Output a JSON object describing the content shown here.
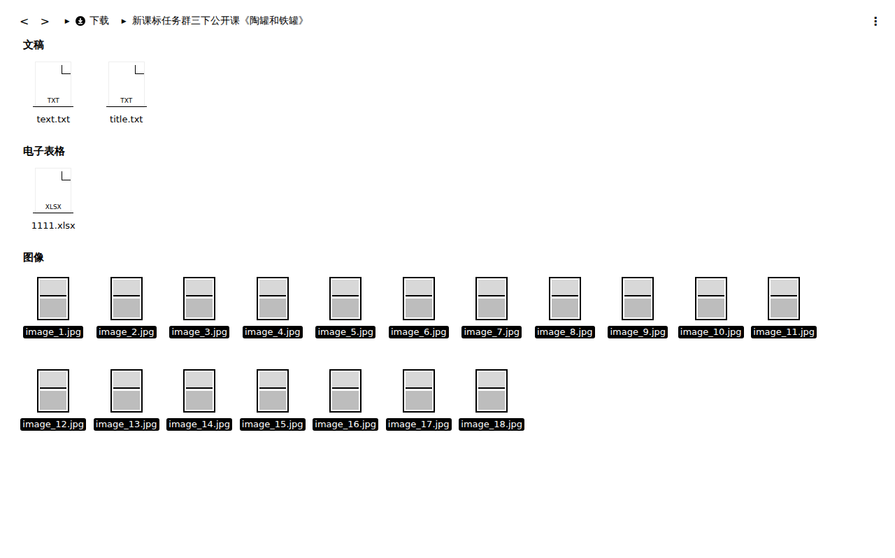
{
  "toolbar": {
    "back": "<",
    "forward": ">",
    "more": "⋮"
  },
  "breadcrumb": [
    {
      "arrow": "▶",
      "label": "下载",
      "kind": "downloads"
    },
    {
      "arrow": "▶",
      "label": "新课标任务群三下公开课《陶罐和铁罐》",
      "kind": "folder"
    }
  ],
  "sections": [
    {
      "title": "文稿",
      "files": [
        {
          "name": "text.txt",
          "badge": "TXT",
          "kind": "document",
          "selected": false
        },
        {
          "name": "title.txt",
          "badge": "TXT",
          "kind": "document",
          "selected": false
        }
      ]
    },
    {
      "title": "电子表格",
      "files": [
        {
          "name": "1111.xlsx",
          "badge": "XLSX",
          "kind": "document",
          "selected": false
        }
      ]
    },
    {
      "title": "图像",
      "files": [
        {
          "name": "image_1.jpg",
          "badge": "",
          "kind": "image",
          "selected": true
        },
        {
          "name": "image_2.jpg",
          "badge": "",
          "kind": "image",
          "selected": true
        },
        {
          "name": "image_3.jpg",
          "badge": "",
          "kind": "image",
          "selected": true
        },
        {
          "name": "image_4.jpg",
          "badge": "",
          "kind": "image",
          "selected": true
        },
        {
          "name": "image_5.jpg",
          "badge": "",
          "kind": "image",
          "selected": true
        },
        {
          "name": "image_6.jpg",
          "badge": "",
          "kind": "image",
          "selected": true
        },
        {
          "name": "image_7.jpg",
          "badge": "",
          "kind": "image",
          "selected": true
        },
        {
          "name": "image_8.jpg",
          "badge": "",
          "kind": "image",
          "selected": true
        },
        {
          "name": "image_9.jpg",
          "badge": "",
          "kind": "image",
          "selected": true
        },
        {
          "name": "image_10.jpg",
          "badge": "",
          "kind": "image",
          "selected": true
        },
        {
          "name": "image_11.jpg",
          "badge": "",
          "kind": "image",
          "selected": true
        },
        {
          "name": "image_12.jpg",
          "badge": "",
          "kind": "image",
          "selected": true
        },
        {
          "name": "image_13.jpg",
          "badge": "",
          "kind": "image",
          "selected": true
        },
        {
          "name": "image_14.jpg",
          "badge": "",
          "kind": "image",
          "selected": true
        },
        {
          "name": "image_15.jpg",
          "badge": "",
          "kind": "image",
          "selected": true
        },
        {
          "name": "image_16.jpg",
          "badge": "",
          "kind": "image",
          "selected": true
        },
        {
          "name": "image_17.jpg",
          "badge": "",
          "kind": "image",
          "selected": true
        },
        {
          "name": "image_18.jpg",
          "badge": "",
          "kind": "image",
          "selected": true
        }
      ]
    }
  ]
}
